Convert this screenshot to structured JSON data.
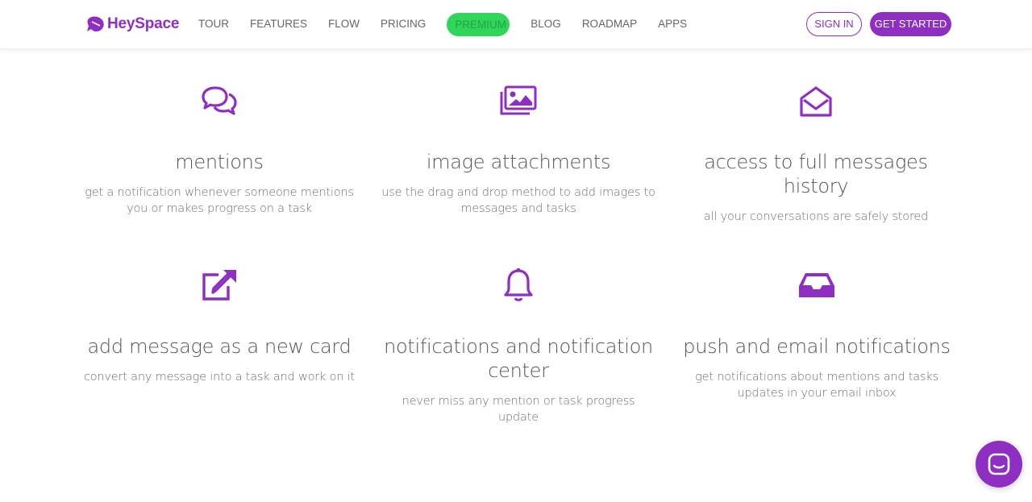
{
  "brand": {
    "name": "HeySpace",
    "color": "#8e2fc2"
  },
  "nav": {
    "items": [
      {
        "label": "TOUR"
      },
      {
        "label": "FEATURES"
      },
      {
        "label": "FLOW"
      },
      {
        "label": "PRICING"
      },
      {
        "label": "PREMIUM",
        "highlight_color": "#2fd659"
      },
      {
        "label": "BLOG"
      },
      {
        "label": "ROADMAP"
      },
      {
        "label": "APPS"
      }
    ]
  },
  "auth": {
    "sign_in": "SIGN IN",
    "get_started": "GET STARTED"
  },
  "features": [
    {
      "icon": "chat-bubbles-icon",
      "title": "mentions",
      "description": "get a notification whenever someone mentions you or makes progress on a task"
    },
    {
      "icon": "images-icon",
      "title": "image attachments",
      "description": "use the drag and drop method to add images to messages and tasks"
    },
    {
      "icon": "open-envelope-icon",
      "title": "access to full messages history",
      "description": "all your conversations are safely stored"
    },
    {
      "icon": "external-edit-icon",
      "title": "add message as a new card",
      "description": "convert any message into a task and work on it"
    },
    {
      "icon": "bell-icon",
      "title": "notifications and notification center",
      "description": "never miss any mention or task progress update"
    },
    {
      "icon": "inbox-tray-icon",
      "title": "push and email notifications",
      "description": "get notifications about mentions and tasks updates in your email inbox"
    }
  ],
  "chat_launcher": {
    "icon": "chat-launcher-icon"
  }
}
